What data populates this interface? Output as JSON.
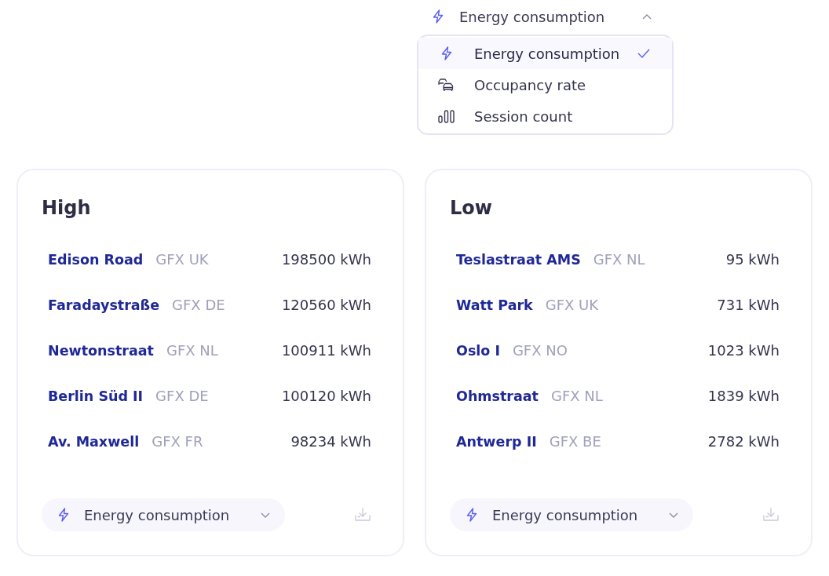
{
  "metric_selector": {
    "label": "Energy consumption",
    "kind": "energy",
    "expanded": true,
    "options": [
      {
        "label": "Energy consumption",
        "kind": "energy",
        "selected": true
      },
      {
        "label": "Occupancy rate",
        "kind": "occupancy",
        "selected": false
      },
      {
        "label": "Session count",
        "kind": "sessions",
        "selected": false
      }
    ]
  },
  "cards": [
    {
      "title": "High",
      "rows": [
        {
          "name": "Edison Road",
          "tag": "GFX UK",
          "value": "198500 kWh"
        },
        {
          "name": "Faradaystraße",
          "tag": "GFX DE",
          "value": "120560 kWh"
        },
        {
          "name": "Newtonstraat",
          "tag": "GFX NL",
          "value": "100911 kWh"
        },
        {
          "name": "Berlin Süd II",
          "tag": "GFX DE",
          "value": "100120 kWh"
        },
        {
          "name": "Av. Maxwell",
          "tag": "GFX FR",
          "value": "98234 kWh"
        }
      ],
      "selector": {
        "label": "Energy consumption",
        "kind": "energy",
        "expanded": false
      }
    },
    {
      "title": "Low",
      "rows": [
        {
          "name": "Teslastraat AMS",
          "tag": "GFX NL",
          "value": "95 kWh"
        },
        {
          "name": "Watt Park",
          "tag": "GFX UK",
          "value": "731 kWh"
        },
        {
          "name": "Oslo I",
          "tag": "GFX NO",
          "value": "1023 kWh"
        },
        {
          "name": "Ohmstraat",
          "tag": "GFX NL",
          "value": "1839 kWh"
        },
        {
          "name": "Antwerp II",
          "tag": "GFX BE",
          "value": "2782 kWh"
        }
      ],
      "selector": {
        "label": "Energy consumption",
        "kind": "energy",
        "expanded": false
      }
    }
  ]
}
